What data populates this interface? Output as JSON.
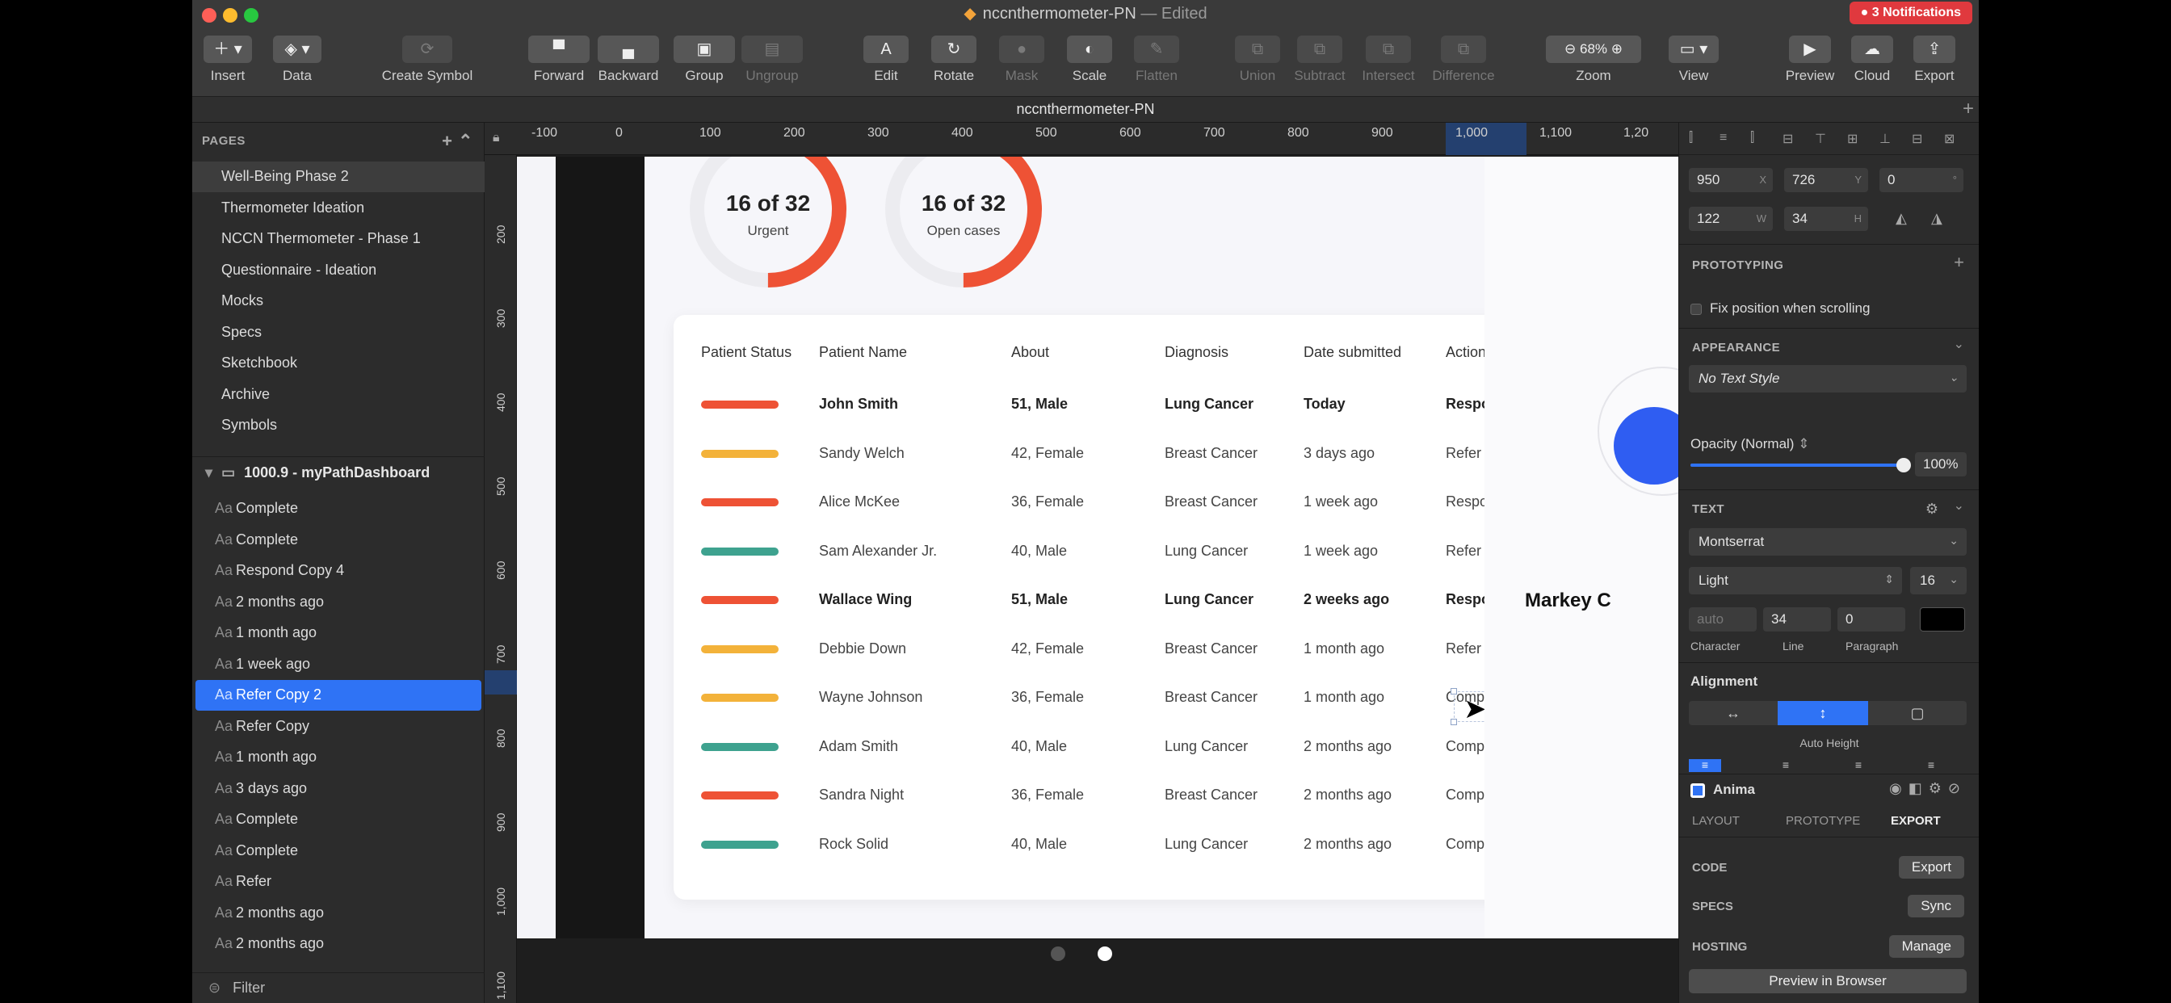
{
  "window": {
    "title": "nccnthermometer-PN",
    "edited_label": "— Edited",
    "notifications": "3 Notifications",
    "tab_title": "nccnthermometer-PN"
  },
  "toolbar": {
    "insert": "Insert",
    "data": "Data",
    "create_symbol": "Create Symbol",
    "forward": "Forward",
    "backward": "Backward",
    "group": "Group",
    "ungroup": "Ungroup",
    "edit": "Edit",
    "rotate": "Rotate",
    "mask": "Mask",
    "scale": "Scale",
    "flatten": "Flatten",
    "union": "Union",
    "subtract": "Subtract",
    "intersect": "Intersect",
    "difference": "Difference",
    "zoom_label": "Zoom",
    "zoom_value": "68%",
    "view": "View",
    "preview": "Preview",
    "cloud": "Cloud",
    "export": "Export"
  },
  "sidebar": {
    "pages_header": "PAGES",
    "pages": [
      "Well-Being Phase 2",
      "Thermometer Ideation",
      "NCCN Thermometer - Phase 1",
      "Questionnaire - Ideation",
      "Mocks",
      "Specs",
      "Sketchbook",
      "Archive",
      "Symbols"
    ],
    "artboard": "1000.9 - myPathDashboard",
    "layers": [
      "Complete",
      "Complete",
      "Respond Copy 4",
      "2 months ago",
      "1 month ago",
      "1 week ago",
      "Refer Copy 2",
      "Refer Copy",
      "1 month ago",
      "3 days ago",
      "Complete",
      "Complete",
      "Refer",
      "2 months ago",
      "2 months ago"
    ],
    "layer_glyph": "Aa",
    "filter": "Filter"
  },
  "rulers": {
    "top": [
      "-100",
      "0",
      "100",
      "200",
      "300",
      "400",
      "500",
      "600",
      "700",
      "800",
      "900",
      "1,000",
      "1,100",
      "1,20"
    ],
    "left": [
      "200",
      "300",
      "400",
      "500",
      "600",
      "700",
      "800",
      "900",
      "1,000",
      "1,100"
    ]
  },
  "dashboard": {
    "donuts": [
      {
        "big": "16 of 32",
        "small": "Urgent",
        "progress": 0.5
      },
      {
        "big": "16 of 32",
        "small": "Open cases",
        "progress": 0.5
      }
    ],
    "headers": [
      "Patient Status",
      "Patient Name",
      "About",
      "Diagnosis",
      "Date submitted",
      "Action"
    ],
    "rows": [
      {
        "status": "red",
        "name": "John Smith",
        "about": "51, Male",
        "diagnosis": "Lung Cancer",
        "date": "Today",
        "action": "Respond",
        "bold": true
      },
      {
        "status": "yellow",
        "name": "Sandy Welch",
        "about": "42, Female",
        "diagnosis": "Breast Cancer",
        "date": "3 days ago",
        "action": "Refer",
        "bold": false
      },
      {
        "status": "red",
        "name": "Alice McKee",
        "about": "36, Female",
        "diagnosis": "Breast Cancer",
        "date": "1 week ago",
        "action": "Respond",
        "bold": false
      },
      {
        "status": "green",
        "name": "Sam Alexander Jr.",
        "about": "40, Male",
        "diagnosis": "Lung Cancer",
        "date": "1 week ago",
        "action": "Refer",
        "bold": false
      },
      {
        "status": "red",
        "name": "Wallace Wing",
        "about": "51, Male",
        "diagnosis": "Lung Cancer",
        "date": "2 weeks ago",
        "action": "Respond",
        "bold": true
      },
      {
        "status": "yellow",
        "name": "Debbie Down",
        "about": "42, Female",
        "diagnosis": "Breast Cancer",
        "date": "1 month ago",
        "action": "Refer",
        "bold": false
      },
      {
        "status": "yellow",
        "name": "Wayne Johnson",
        "about": "36, Female",
        "diagnosis": "Breast Cancer",
        "date": "1 month ago",
        "action": "Complete",
        "bold": false
      },
      {
        "status": "green",
        "name": "Adam Smith",
        "about": "40, Male",
        "diagnosis": "Lung Cancer",
        "date": "2 months ago",
        "action": "Complete",
        "bold": false
      },
      {
        "status": "red",
        "name": "Sandra Night",
        "about": "36, Female",
        "diagnosis": "Breast Cancer",
        "date": "2 months ago",
        "action": "Complete",
        "bold": false
      },
      {
        "status": "green",
        "name": "Rock Solid",
        "about": "40, Male",
        "diagnosis": "Lung Cancer",
        "date": "2 months ago",
        "action": "Complete",
        "bold": false
      }
    ],
    "peek_name": "Markey C"
  },
  "inspector": {
    "x": "950",
    "x_label": "X",
    "y": "726",
    "y_label": "Y",
    "rotation": "0",
    "rotation_label": "°",
    "w": "122",
    "w_label": "W",
    "h": "34",
    "h_label": "H",
    "prototyping": "PROTOTYPING",
    "fix_position": "Fix position when scrolling",
    "appearance": "APPEARANCE",
    "text_style": "No Text Style",
    "opacity_label": "Opacity (Normal)",
    "opacity_value": "100%",
    "opacity": 1.0,
    "text_section": "TEXT",
    "font_family": "Montserrat",
    "font_weight": "Light",
    "font_size": "16",
    "character_placeholder": "auto",
    "line_value": "34",
    "paragraph_value": "0",
    "character_label": "Character",
    "line_label": "Line",
    "paragraph_label": "Paragraph",
    "alignment": "Alignment",
    "auto_height": "Auto Height",
    "anima": "Anima",
    "anima_tabs": [
      "LAYOUT",
      "PROTOTYPE",
      "EXPORT"
    ],
    "code": "CODE",
    "code_btn": "Export",
    "specs": "SPECS",
    "specs_btn": "Sync",
    "hosting": "HOSTING",
    "hosting_btn": "Manage",
    "preview_btn": "Preview in Browser"
  },
  "colors": {
    "red": "#ee5235",
    "yellow": "#f3b23a",
    "green": "#3ea28f",
    "accent": "#2f73f5"
  }
}
